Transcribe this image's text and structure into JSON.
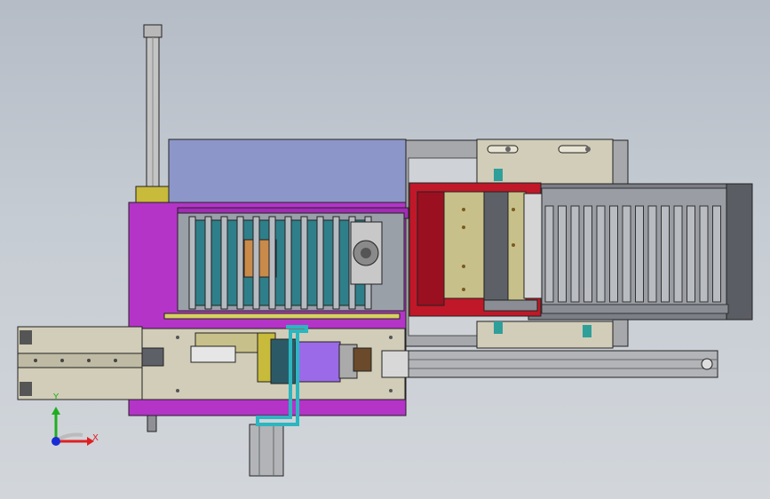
{
  "viewport": {
    "background_top": "#b5bcc6",
    "background_bottom": "#d2d6db"
  },
  "triad": {
    "x_label": "X",
    "y_label": "Y",
    "x_color": "#e02020",
    "y_color": "#1fae1f",
    "z_color": "#1a2bd6"
  },
  "colors": {
    "purple_base": "#b434c8",
    "steel_panel": "#8d96c8",
    "red_block": "#c01828",
    "khaki": "#c8c08a",
    "beige": "#d2cdb8",
    "gray_rail": "#a7a8ab",
    "dark_teal": "#2f7f8a",
    "cyan": "#33c6d0",
    "violet_motor": "#9b6ae8",
    "olive": "#c8ba3a",
    "orange_pad": "#c98a4a"
  },
  "icons": [
    "axis-triad-icon"
  ]
}
